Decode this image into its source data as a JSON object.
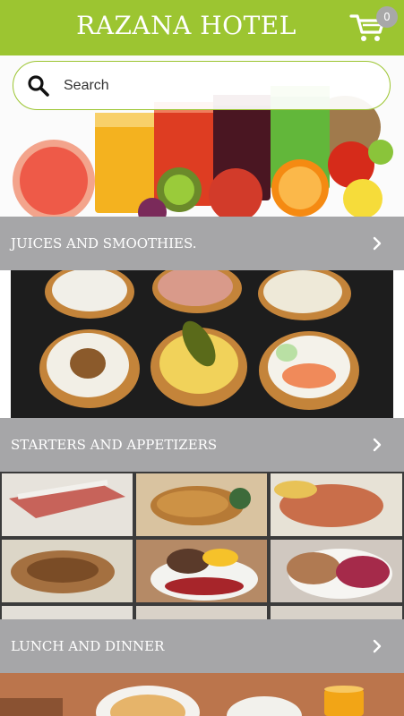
{
  "header": {
    "title": "RAZANA HOTEL",
    "cart_count": "0",
    "cart_icon": "shopping-cart-icon"
  },
  "search": {
    "placeholder": "Search",
    "icon": "search-icon"
  },
  "categories": [
    {
      "label": "JUICES AND SMOOTHIES."
    },
    {
      "label": "STARTERS AND APPETIZERS"
    },
    {
      "label": "LUNCH AND DINNER"
    }
  ],
  "colors": {
    "header": "#9cc531",
    "category_bar": "#a6a6a8",
    "badge": "#a8a8a8"
  }
}
